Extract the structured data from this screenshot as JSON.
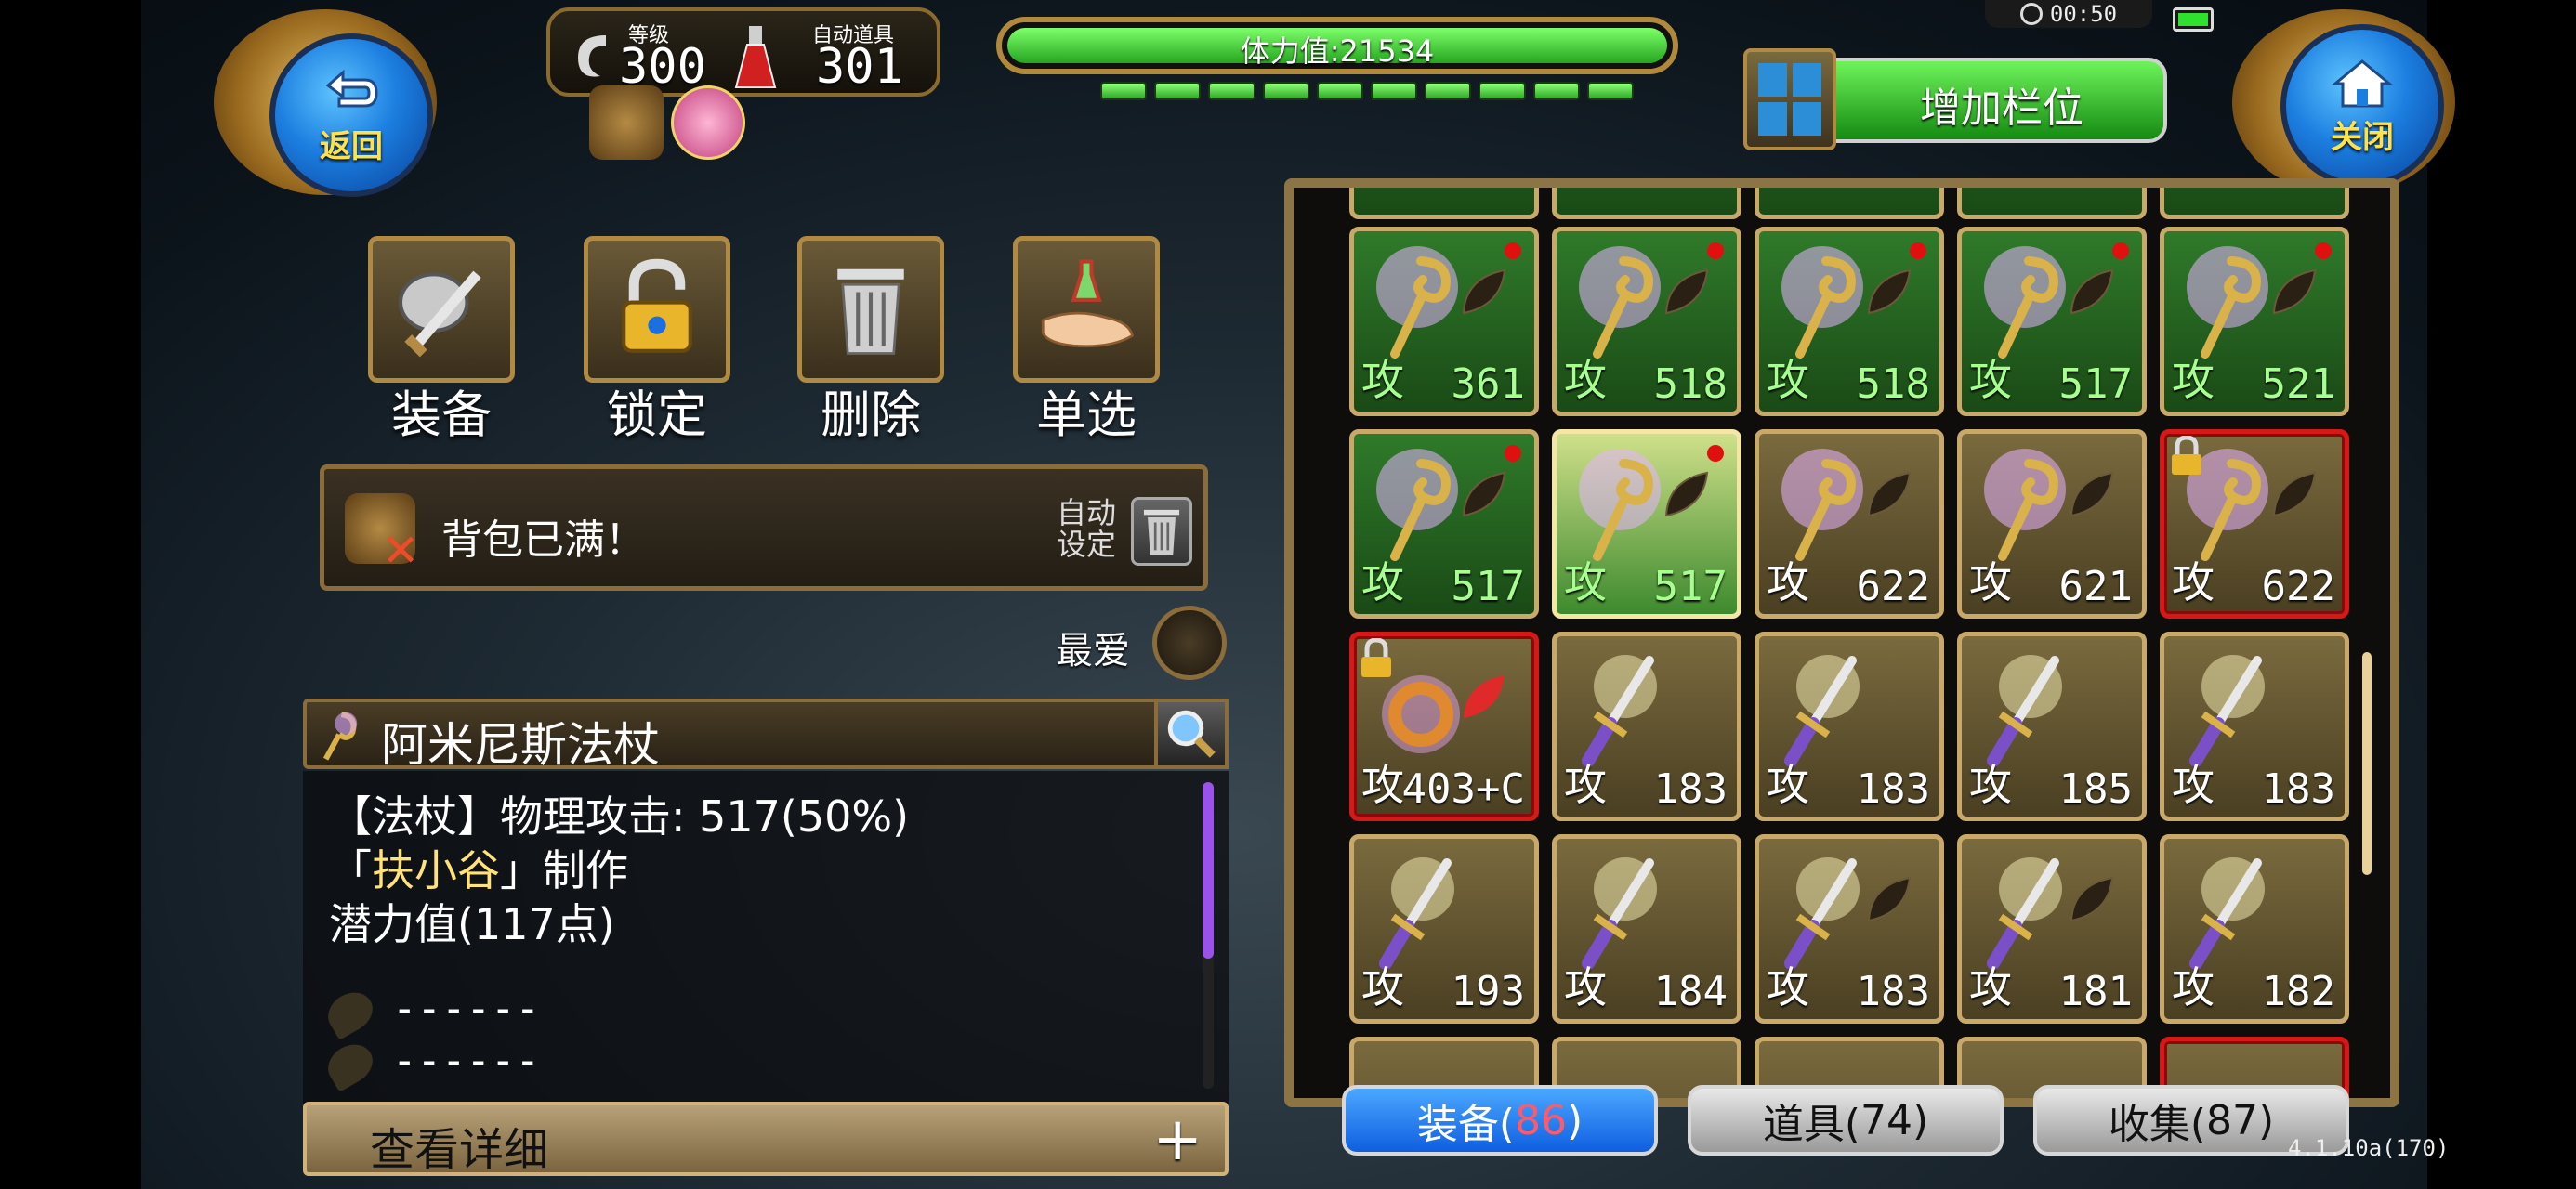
{
  "hud": {
    "back_label": "返回",
    "close_label": "关闭",
    "level_label": "等级",
    "level_value": "300",
    "auto_item_label": "自动道具",
    "auto_item_value": "301",
    "stamina_label": "体力值:21534",
    "stamina_segments": 10,
    "stamina_filled": 10,
    "clock": "00:50",
    "add_slot_label": "增加栏位"
  },
  "actions": [
    {
      "label": "装备",
      "icon": "armor-sword-icon"
    },
    {
      "label": "锁定",
      "icon": "padlock-icon"
    },
    {
      "label": "删除",
      "icon": "trash-icon"
    },
    {
      "label": "单选",
      "icon": "hand-potion-icon"
    }
  ],
  "bag": {
    "full_text": "背包已满！",
    "auto_line1": "自动",
    "auto_line2": "设定",
    "favorite_label": "最爱"
  },
  "detail": {
    "item_name": "阿米尼斯法杖",
    "line1": "【法杖】物理攻击: 517(50%)",
    "line2_prefix": "「",
    "line2_name": "扶小谷",
    "line2_suffix": "」制作",
    "line3": "潜力值(117点)",
    "slot1": "------",
    "slot2": "------",
    "view_detail": "查看详细",
    "plus": "+"
  },
  "grid": {
    "atk_char": "攻",
    "rows": [
      [
        {
          "val": "361",
          "style": "green",
          "item": "staff",
          "dot": true
        },
        {
          "val": "518",
          "style": "green",
          "item": "staff",
          "dot": true
        },
        {
          "val": "518",
          "style": "green",
          "item": "staff",
          "dot": true
        },
        {
          "val": "517",
          "style": "green",
          "item": "staff",
          "dot": true
        },
        {
          "val": "521",
          "style": "green",
          "item": "staff",
          "dot": true
        }
      ],
      [
        {
          "val": "517",
          "style": "green",
          "item": "staff",
          "dot": true
        },
        {
          "val": "517",
          "style": "sel",
          "item": "staff",
          "dot": true
        },
        {
          "val": "622",
          "style": "gold",
          "item": "staff",
          "dot": false
        },
        {
          "val": "621",
          "style": "gold",
          "item": "staff",
          "dot": false
        },
        {
          "val": "622",
          "style": "red",
          "item": "staff",
          "dot": false,
          "lock": true
        }
      ],
      [
        {
          "val": "403+C",
          "style": "red",
          "item": "ring",
          "dot": false,
          "lock": true
        },
        {
          "val": "183",
          "style": "gold",
          "item": "sword",
          "dot": false
        },
        {
          "val": "183",
          "style": "gold",
          "item": "sword",
          "dot": false
        },
        {
          "val": "185",
          "style": "gold",
          "item": "sword",
          "dot": false
        },
        {
          "val": "183",
          "style": "gold",
          "item": "sword",
          "dot": false
        }
      ],
      [
        {
          "val": "193",
          "style": "gold",
          "item": "sword",
          "dot": false
        },
        {
          "val": "184",
          "style": "gold",
          "item": "sword",
          "dot": false
        },
        {
          "val": "183",
          "style": "gold",
          "item": "sword",
          "dot": false
        },
        {
          "val": "181",
          "style": "gold",
          "item": "sword",
          "dot": false
        },
        {
          "val": "182",
          "style": "gold",
          "item": "sword",
          "dot": false
        }
      ]
    ]
  },
  "tabs": [
    {
      "label": "装备(",
      "count": "86",
      "close": ")",
      "active": true
    },
    {
      "label": "道具(",
      "count": "74",
      "close": ")",
      "active": false
    },
    {
      "label": "收集(",
      "count": "87",
      "close": ")",
      "active": false
    }
  ],
  "version": "4.1.10a(170)"
}
